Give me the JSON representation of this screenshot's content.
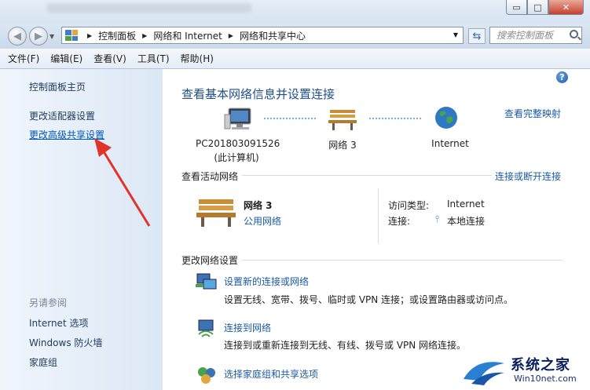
{
  "window": {
    "controls": {
      "minimize": "▭",
      "maximize": "□",
      "close": "✕"
    }
  },
  "address": {
    "breadcrumb": [
      "控制面板",
      "网络和 Internet",
      "网络和共享中心"
    ],
    "search_placeholder": "搜索控制面板"
  },
  "menu": [
    "文件(F)",
    "编辑(E)",
    "查看(V)",
    "工具(T)",
    "帮助(H)"
  ],
  "sidebar": {
    "home": "控制面板主页",
    "items": [
      "更改适配器设置",
      "更改高级共享设置"
    ],
    "see_also_title": "另请参阅",
    "see_also": [
      "Internet 选项",
      "Windows 防火墙",
      "家庭组"
    ]
  },
  "main": {
    "title": "查看基本网络信息并设置连接",
    "full_map_link": "查看完整映射",
    "map": {
      "computer_name": "PC201803091526",
      "computer_sub": "(此计算机)",
      "network": "网络  3",
      "internet": "Internet"
    },
    "active": {
      "title": "查看活动网络",
      "toggle_link": "连接或断开连接",
      "network_name": "网络  3",
      "network_type": "公用网络",
      "access_type_label": "访问类型:",
      "access_type_value": "Internet",
      "connections_label": "连接:",
      "connections_value": "本地连接"
    },
    "change": {
      "title": "更改网络设置",
      "tasks": [
        {
          "link": "设置新的连接或网络",
          "desc": "设置无线、宽带、拨号、临时或 VPN 连接；或设置路由器或访问点。"
        },
        {
          "link": "连接到网络",
          "desc": "连接到或重新连接到无线、有线、拨号或 VPN 网络连接。"
        },
        {
          "link": "选择家庭组和共享选项",
          "desc": ""
        }
      ]
    }
  },
  "watermark": {
    "title": "系统之家",
    "url": "Win10net.com"
  },
  "colors": {
    "link": "#1b5aa5",
    "heading": "#1e4e8a",
    "sidebar_bg": "#dce8f6",
    "arrow": "#e2332a"
  }
}
